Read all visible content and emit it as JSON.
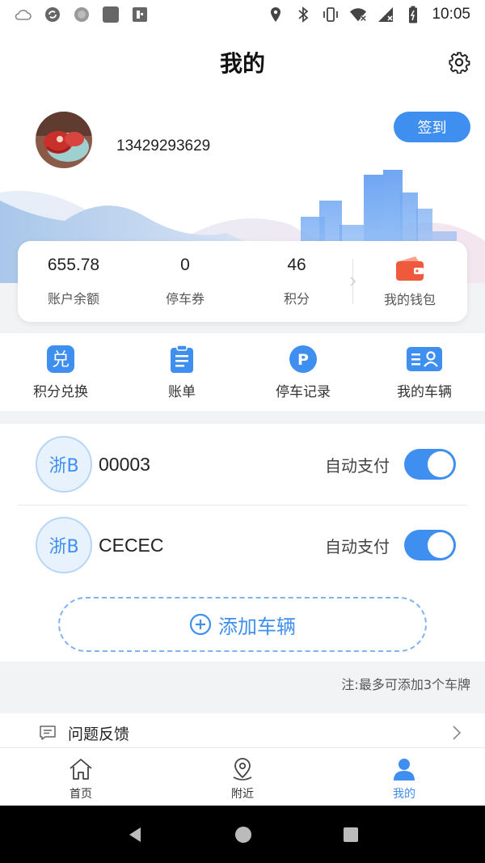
{
  "status_bar": {
    "time": "10:05",
    "left_icons": [
      "weather-icon",
      "sync-icon",
      "circle-app-icon",
      "square-app-icon",
      "nfc-icon"
    ],
    "right_icons": [
      "location-icon",
      "bluetooth-icon",
      "vibrate-icon",
      "wifi-off-icon",
      "signal-icon",
      "battery-icon"
    ]
  },
  "header": {
    "title": "我的",
    "settings_icon": "gear-icon"
  },
  "profile": {
    "phone": "13429293629",
    "sign_in_label": "签到"
  },
  "stats": {
    "balance": {
      "value": "655.78",
      "label": "账户余额"
    },
    "coupons": {
      "value": "0",
      "label": "停车券"
    },
    "points": {
      "value": "46",
      "label": "积分"
    },
    "wallet": {
      "label": "我的钱包",
      "icon": "wallet-icon"
    }
  },
  "quick_menu": [
    {
      "label": "积分兑换",
      "icon": "exchange-icon",
      "glyph": "兑"
    },
    {
      "label": "账单",
      "icon": "clipboard-icon"
    },
    {
      "label": "停车记录",
      "icon": "parking-icon",
      "glyph": "P"
    },
    {
      "label": "我的车辆",
      "icon": "vehicle-card-icon"
    }
  ],
  "vehicles": [
    {
      "province": "浙B",
      "plate": "00003",
      "auto_pay_label": "自动支付",
      "auto_pay": true
    },
    {
      "province": "浙B",
      "plate": "CECEC",
      "auto_pay_label": "自动支付",
      "auto_pay": true
    }
  ],
  "add_vehicle_label": "添加车辆",
  "note": "注:最多可添加3个车牌",
  "feedback": {
    "label": "问题反馈"
  },
  "tabs": [
    {
      "label": "首页",
      "icon": "home-icon",
      "active": false
    },
    {
      "label": "附近",
      "icon": "location-pin-icon",
      "active": false
    },
    {
      "label": "我的",
      "icon": "person-icon",
      "active": true
    }
  ],
  "colors": {
    "accent": "#3f8ff0",
    "wallet": "#f05a3c",
    "background": "#f2f3f5"
  }
}
